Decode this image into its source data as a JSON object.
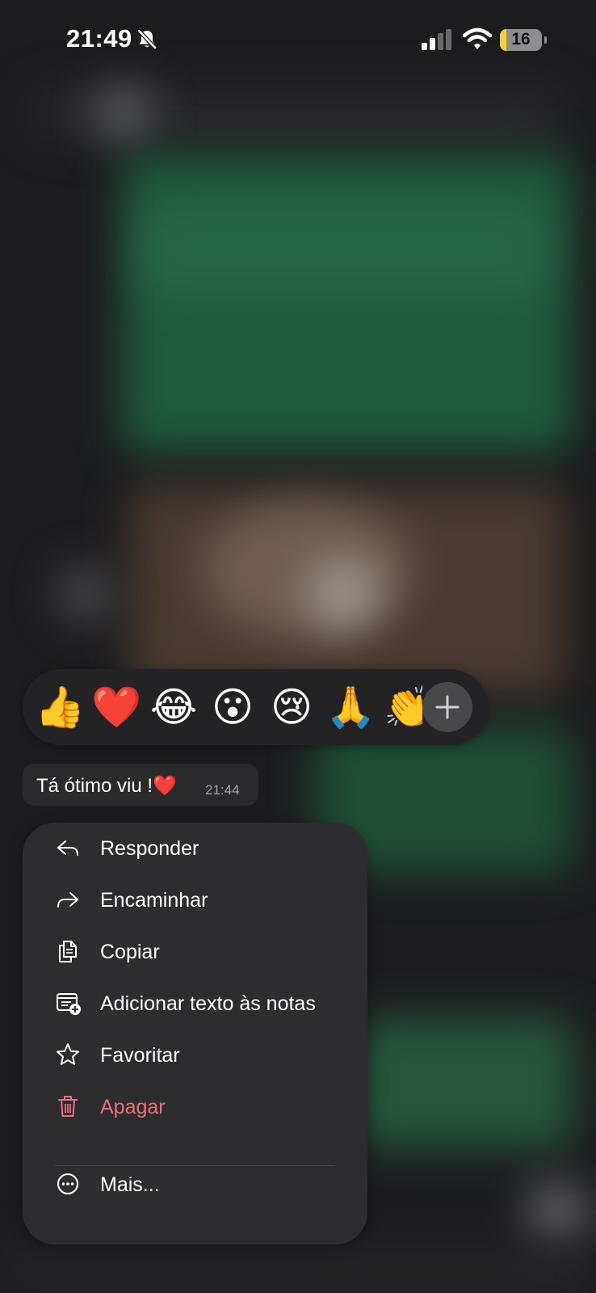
{
  "status_bar": {
    "time": "21:49",
    "battery_level": "16",
    "battery_fraction": 0.16,
    "silent_icon": "bell-slash-icon",
    "signal_icon": "cellular-signal-icon",
    "wifi_icon": "wifi-icon"
  },
  "reactions": {
    "emojis": [
      "👍",
      "❤️",
      "😂",
      "😮",
      "😢",
      "🙏",
      "👏"
    ],
    "selected": "❤️",
    "more_icon": "plus-icon"
  },
  "message": {
    "text": "Tá ótimo viu !❤️",
    "time": "21:44"
  },
  "menu": {
    "items": [
      {
        "label": "Responder",
        "icon": "reply-icon"
      },
      {
        "label": "Encaminhar",
        "icon": "forward-icon"
      },
      {
        "label": "Copiar",
        "icon": "copy-icon"
      },
      {
        "label": "Adicionar texto às notas",
        "icon": "add-note-icon"
      },
      {
        "label": "Favoritar",
        "icon": "star-icon"
      },
      {
        "label": "Apagar",
        "icon": "trash-icon"
      },
      {
        "label": "Mais...",
        "icon": "more-ellipsis-icon"
      }
    ]
  },
  "colors": {
    "background": "#1c1c1e",
    "menu": "#2d2d2f",
    "danger": "#e9707d",
    "battery_low": "#f4d03a",
    "chat_green": "#245c40"
  }
}
